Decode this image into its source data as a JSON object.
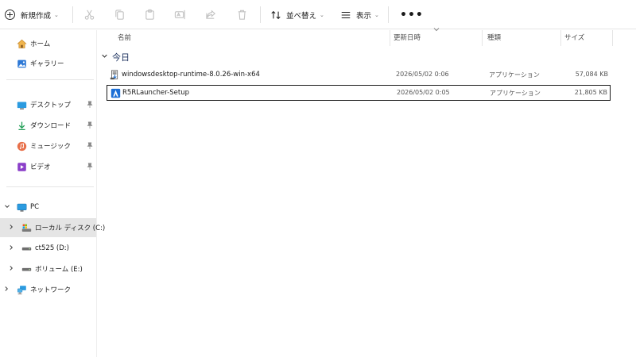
{
  "toolbar": {
    "new_label": "新規作成",
    "sort_label": "並べ替え",
    "view_label": "表示",
    "more_label": "•••",
    "chevron": "⌄",
    "icons": [
      "cut-icon",
      "copy-icon",
      "paste-icon",
      "rename-icon",
      "share-icon",
      "delete-icon"
    ]
  },
  "sidebar": {
    "quick": [
      {
        "label": "ホーム",
        "icon": "home-icon"
      },
      {
        "label": "ギャラリー",
        "icon": "gallery-icon"
      }
    ],
    "pinned": [
      {
        "label": "デスクトップ",
        "icon": "desktop-icon"
      },
      {
        "label": "ダウンロード",
        "icon": "download-icon"
      },
      {
        "label": "ミュージック",
        "icon": "music-icon"
      },
      {
        "label": "ビデオ",
        "icon": "video-icon"
      }
    ],
    "pin_glyph": "📌",
    "pc_label": "PC",
    "drives": [
      {
        "label": "ローカル ディスク (C:)",
        "icon": "local-disk-icon",
        "selected": true
      },
      {
        "label": "ct525 (D:)",
        "icon": "drive-icon",
        "selected": false
      },
      {
        "label": "ボリューム (E:)",
        "icon": "drive-icon",
        "selected": false
      }
    ],
    "network_label": "ネットワーク"
  },
  "columns": {
    "name": "名前",
    "date": "更新日時",
    "type": "種類",
    "size": "サイズ"
  },
  "group": {
    "label": "今日",
    "chevron": "⌄"
  },
  "files": [
    {
      "name": "windowsdesktop-runtime-8.0.26-win-x64",
      "date": "2026/05/02 0:06",
      "type": "アプリケーション",
      "size": "57,084 KB",
      "icon": "installer-icon",
      "selected": false
    },
    {
      "name": "R5RLauncher-Setup",
      "date": "2026/05/02 0:05",
      "type": "アプリケーション",
      "size": "21,805 KB",
      "icon": "launcher-app-icon",
      "selected": true
    }
  ],
  "colors": {
    "accent": "#0067c0",
    "selected_bg": "#e5e5e5",
    "group_text": "#1a2f5c"
  }
}
